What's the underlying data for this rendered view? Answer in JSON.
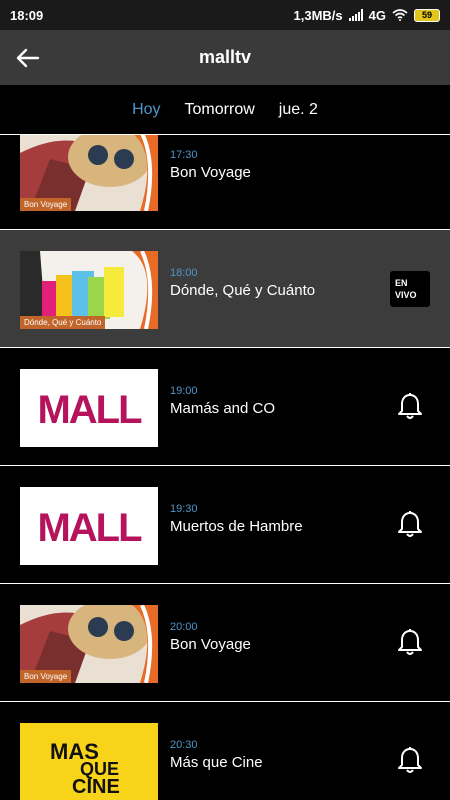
{
  "status": {
    "time": "18:09",
    "speed": "1,3MB/s",
    "network": "4G",
    "battery": "59"
  },
  "appbar": {
    "title": "malltv"
  },
  "tabs": [
    {
      "label": "Hoy",
      "active": true
    },
    {
      "label": "Tomorrow",
      "active": false
    },
    {
      "label": "jue. 2",
      "active": false
    }
  ],
  "programs": [
    {
      "time": "17:30",
      "title": "Bon Voyage",
      "thumb": "bon-voyage",
      "thumb_label": "Bon Voyage",
      "action": "none"
    },
    {
      "time": "18:00",
      "title": "Dónde, Qué y Cuánto",
      "thumb": "shopping",
      "thumb_label": "Dónde, Qué y Cuánto",
      "action": "live",
      "badge": [
        "EN",
        "VIVO"
      ]
    },
    {
      "time": "19:00",
      "title": "Mamás and CO",
      "thumb": "mall-logo",
      "thumb_label": "MALL",
      "action": "bell"
    },
    {
      "time": "19:30",
      "title": "Muertos de Hambre",
      "thumb": "mall-logo",
      "thumb_label": "MALL",
      "action": "bell"
    },
    {
      "time": "20:00",
      "title": "Bon Voyage",
      "thumb": "bon-voyage",
      "thumb_label": "Bon Voyage",
      "action": "bell"
    },
    {
      "time": "20:30",
      "title": "Más que Cine",
      "thumb": "mas-que-cine",
      "thumb_label": [
        "MAS",
        "QUE",
        "CINE"
      ],
      "action": "bell"
    }
  ],
  "colors": {
    "accent": "#4f95c9",
    "appbar": "#3a3a3a",
    "live_row": "#3c3c3c",
    "mall_magenta": "#b5135c",
    "cine_yellow": "#f7d31a"
  }
}
